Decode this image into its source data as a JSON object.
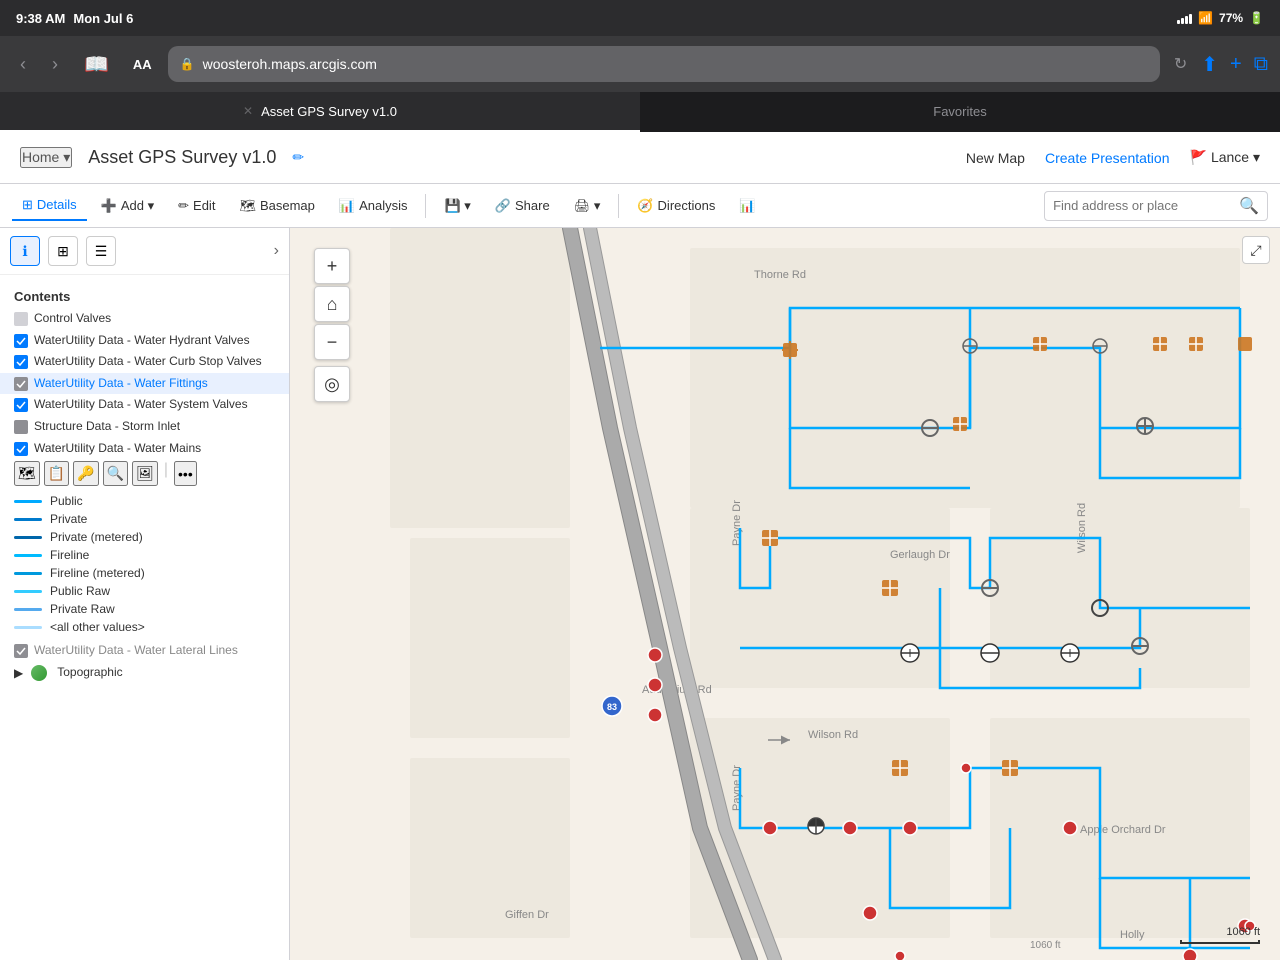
{
  "status_bar": {
    "time": "9:38 AM",
    "date": "Mon Jul 6",
    "battery": "77%"
  },
  "browser": {
    "url": "woosteroh.maps.arcgis.com",
    "aa_label": "AA",
    "reload_label": "↻"
  },
  "tabs": [
    {
      "id": "tab1",
      "label": "Asset GPS Survey v1.0",
      "active": true
    },
    {
      "id": "tab2",
      "label": "Favorites",
      "active": false
    }
  ],
  "app_header": {
    "home_label": "Home ▾",
    "title": "Asset GPS Survey v1.0",
    "edit_icon": "✏",
    "new_map_label": "New Map",
    "create_presentation_label": "Create Presentation",
    "user_label": "Lance ▾",
    "user_icon": "🚩"
  },
  "toolbar": {
    "details_label": "Details",
    "add_label": "Add ▾",
    "edit_label": "Edit",
    "basemap_label": "Basemap",
    "analysis_label": "Analysis",
    "save_label": "💾 ▾",
    "share_label": "Share",
    "print_label": "🖨 ▾",
    "directions_label": "Directions",
    "chart_label": "📊",
    "search_placeholder": "Find address or place"
  },
  "sidebar": {
    "info_icon": "ℹ",
    "grid_icon": "⊞",
    "list_icon": "☰",
    "contents_label": "Contents",
    "layers": [
      {
        "id": "control-valves",
        "label": "Control Valves",
        "checked": false,
        "partial": false,
        "highlighted": false
      },
      {
        "id": "water-hydrant",
        "label": "WaterUtility Data - Water Hydrant Valves",
        "checked": true,
        "partial": false,
        "highlighted": false
      },
      {
        "id": "water-curb",
        "label": "WaterUtility Data - Water Curb Stop Valves",
        "checked": true,
        "partial": false,
        "highlighted": false
      },
      {
        "id": "water-fittings",
        "label": "WaterUtility Data - Water Fittings",
        "checked": false,
        "partial": true,
        "highlighted": true,
        "link": true
      },
      {
        "id": "water-system-valves",
        "label": "WaterUtility Data - Water System Valves",
        "checked": true,
        "partial": false,
        "highlighted": false
      },
      {
        "id": "storm-inlet",
        "label": "Structure Data - Storm Inlet",
        "checked": false,
        "partial": false,
        "highlighted": false
      },
      {
        "id": "water-mains",
        "label": "WaterUtility Data - Water Mains",
        "checked": true,
        "partial": false,
        "highlighted": false
      }
    ],
    "legend_items": [
      {
        "id": "public",
        "label": "Public",
        "color": "#00aaff"
      },
      {
        "id": "private",
        "label": "Private",
        "color": "#007acc"
      },
      {
        "id": "private-metered",
        "label": "Private (metered)",
        "color": "#0066aa"
      },
      {
        "id": "fireline",
        "label": "Fireline",
        "color": "#00bbff"
      },
      {
        "id": "fireline-metered",
        "label": "Fireline (metered)",
        "color": "#0099dd"
      },
      {
        "id": "public-raw",
        "label": "Public Raw",
        "color": "#33ccff"
      },
      {
        "id": "private-raw",
        "label": "Private Raw",
        "color": "#55aaee"
      },
      {
        "id": "other-values",
        "label": "<all other values>",
        "color": "#aaddff"
      }
    ],
    "bottom_layers": [
      {
        "id": "water-lateral",
        "label": "WaterUtility Data - Water Lateral Lines",
        "checked": true,
        "partial": false
      },
      {
        "id": "topographic",
        "label": "Topographic",
        "checked": false,
        "partial": false,
        "expandable": true
      }
    ],
    "legend_icons": [
      "🗺",
      "📋",
      "🔑",
      "🔍",
      "🖼",
      "•••"
    ]
  },
  "map": {
    "roads": [
      {
        "id": "thorne-rd",
        "label": "Thorne Rd"
      },
      {
        "id": "payne-dr",
        "label": "Payne Dr"
      },
      {
        "id": "wilson-rd",
        "label": "Wilson Rd"
      },
      {
        "id": "gerlaugh-dr",
        "label": "Gerlaugh Dr"
      },
      {
        "id": "auditorium-rd",
        "label": "Auditorium Rd"
      },
      {
        "id": "giffen-dr",
        "label": "Giffen Dr"
      },
      {
        "id": "apple-orchard-dr",
        "label": "Apple Orchard Dr"
      },
      {
        "id": "holly",
        "label": "Holly"
      }
    ],
    "scale_label": "1060 ft",
    "route_83": "83"
  }
}
